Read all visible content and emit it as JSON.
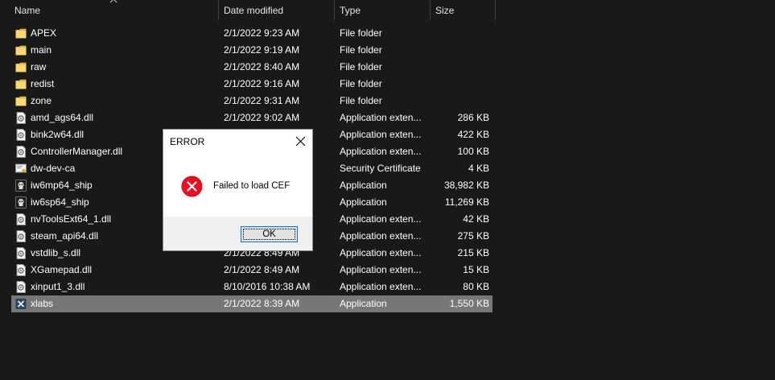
{
  "columns": {
    "name": "Name",
    "date": "Date modified",
    "type": "Type",
    "size": "Size"
  },
  "files": [
    {
      "name": "APEX",
      "date": "2/1/2022 9:23 AM",
      "type": "File folder",
      "size": "",
      "icon": "folder"
    },
    {
      "name": "main",
      "date": "2/1/2022 9:19 AM",
      "type": "File folder",
      "size": "",
      "icon": "folder"
    },
    {
      "name": "raw",
      "date": "2/1/2022 8:40 AM",
      "type": "File folder",
      "size": "",
      "icon": "folder"
    },
    {
      "name": "redist",
      "date": "2/1/2022 9:16 AM",
      "type": "File folder",
      "size": "",
      "icon": "folder"
    },
    {
      "name": "zone",
      "date": "2/1/2022 9:31 AM",
      "type": "File folder",
      "size": "",
      "icon": "folder"
    },
    {
      "name": "amd_ags64.dll",
      "date": "2/1/2022 9:02 AM",
      "type": "Application exten...",
      "size": "286 KB",
      "icon": "dll"
    },
    {
      "name": "bink2w64.dll",
      "date": "",
      "type": "Application exten...",
      "size": "422 KB",
      "icon": "dll"
    },
    {
      "name": "ControllerManager.dll",
      "date": "",
      "type": "Application exten...",
      "size": "100 KB",
      "icon": "dll"
    },
    {
      "name": "dw-dev-ca",
      "date": "",
      "type": "Security Certificate",
      "size": "4 KB",
      "icon": "certificate"
    },
    {
      "name": "iw6mp64_ship",
      "date": "",
      "type": "Application",
      "size": "38,982 KB",
      "icon": "game-exe"
    },
    {
      "name": "iw6sp64_ship",
      "date": "",
      "type": "Application",
      "size": "11,269 KB",
      "icon": "game-exe"
    },
    {
      "name": "nvToolsExt64_1.dll",
      "date": "",
      "type": "Application exten...",
      "size": "42 KB",
      "icon": "dll"
    },
    {
      "name": "steam_api64.dll",
      "date": "",
      "type": "Application exten...",
      "size": "275 KB",
      "icon": "dll"
    },
    {
      "name": "vstdlib_s.dll",
      "date": "2/1/2022 8:49 AM",
      "type": "Application exten...",
      "size": "215 KB",
      "icon": "dll"
    },
    {
      "name": "XGamepad.dll",
      "date": "2/1/2022 8:49 AM",
      "type": "Application exten...",
      "size": "15 KB",
      "icon": "dll"
    },
    {
      "name": "xinput1_3.dll",
      "date": "8/10/2016 10:38 AM",
      "type": "Application exten...",
      "size": "80 KB",
      "icon": "dll"
    },
    {
      "name": "xlabs",
      "date": "2/1/2022 8:39 AM",
      "type": "Application",
      "size": "1,550 KB",
      "icon": "xlabs-exe",
      "selected": true
    }
  ],
  "dialog": {
    "title": "ERROR",
    "message": "Failed to load CEF",
    "ok_label": "OK",
    "icon": "error-icon"
  },
  "colors": {
    "background": "#191919",
    "selected_row": "#777777",
    "folder": "#f8d775",
    "error_red": "#e81123",
    "button_focus": "#0078d7"
  }
}
